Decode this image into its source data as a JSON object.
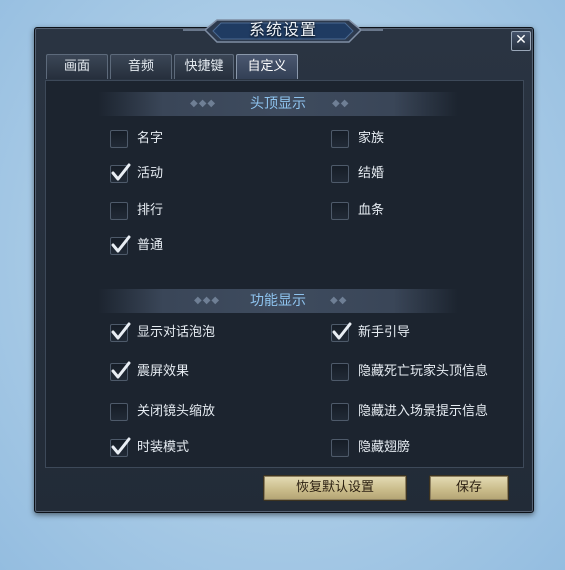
{
  "window": {
    "title": "系统设置",
    "close_icon": "close-icon"
  },
  "tabs": [
    {
      "label": "画面",
      "active": false
    },
    {
      "label": "音频",
      "active": false
    },
    {
      "label": "快捷键",
      "active": false
    },
    {
      "label": "自定义",
      "active": true
    }
  ],
  "sections": [
    {
      "title": "头顶显示",
      "options": [
        {
          "label": "名字",
          "checked": false
        },
        {
          "label": "家族",
          "checked": false
        },
        {
          "label": "活动",
          "checked": true
        },
        {
          "label": "结婚",
          "checked": false
        },
        {
          "label": "排行",
          "checked": false
        },
        {
          "label": "血条",
          "checked": false
        },
        {
          "label": "普通",
          "checked": true
        }
      ]
    },
    {
      "title": "功能显示",
      "options": [
        {
          "label": "显示对话泡泡",
          "checked": true
        },
        {
          "label": "新手引导",
          "checked": true
        },
        {
          "label": "震屏效果",
          "checked": true
        },
        {
          "label": "隐藏死亡玩家头顶信息",
          "checked": false
        },
        {
          "label": "关闭镜头缩放",
          "checked": false
        },
        {
          "label": "隐藏进入场景提示信息",
          "checked": false
        },
        {
          "label": "时装模式",
          "checked": true
        },
        {
          "label": "隐藏翅膀",
          "checked": false
        }
      ]
    }
  ],
  "buttons": {
    "restore_defaults": "恢复默认设置",
    "save": "保存"
  },
  "colors": {
    "section_title": "#8ec3ee",
    "panel_bg": "#222b37",
    "button_gold": "#cbbd8c"
  }
}
